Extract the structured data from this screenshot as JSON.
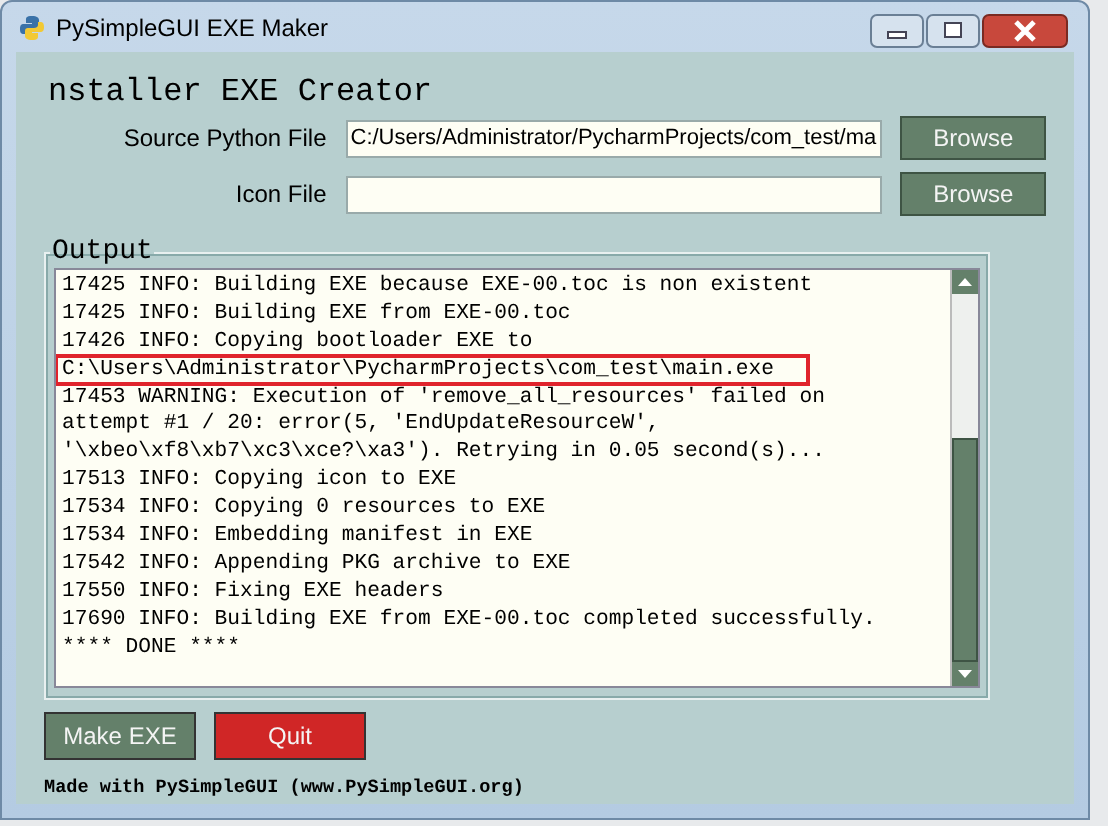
{
  "window": {
    "title": "PySimpleGUI EXE Maker"
  },
  "heading": "nstaller EXE Creator",
  "fields": [
    {
      "label": "Source Python File",
      "value": "C:/Users/Administrator/PycharmProjects/com_test/ma",
      "button": "Browse"
    },
    {
      "label": "Icon File",
      "button": "Browse"
    }
  ],
  "output": {
    "title": "Output",
    "lines": [
      {
        "text": "17425 INFO: Building EXE because EXE-00.toc is non existent",
        "highlighted": false
      },
      {
        "text": "17425 INFO: Building EXE from EXE-00.toc",
        "highlighted": false
      },
      {
        "text": "17426 INFO: Copying bootloader EXE to",
        "highlighted": false
      },
      {
        "text": "C:\\Users\\Administrator\\PycharmProjects\\com_test\\main.exe",
        "highlighted": true
      },
      {
        "text": "17453 WARNING: Execution of 'remove_all_resources' failed on",
        "highlighted": false
      },
      {
        "text": "attempt #1 / 20: error(5, 'EndUpdateResourceW',",
        "highlighted": false
      },
      {
        "text": "'\\xbeo\\xf8\\xb7\\xc3\\xce?\\xa3'). Retrying in 0.05 second(s)...",
        "highlighted": false
      },
      {
        "text": "17513 INFO: Copying icon to EXE",
        "highlighted": false
      },
      {
        "text": "17534 INFO: Copying 0 resources to EXE",
        "highlighted": false
      },
      {
        "text": "17534 INFO: Embedding manifest in EXE",
        "highlighted": false
      },
      {
        "text": "17542 INFO: Appending PKG archive to EXE",
        "highlighted": false
      },
      {
        "text": "17550 INFO: Fixing EXE headers",
        "highlighted": false
      },
      {
        "text": "17690 INFO: Building EXE from EXE-00.toc completed successfully.",
        "highlighted": false
      },
      {
        "text": "**** DONE ****",
        "highlighted": false
      }
    ]
  },
  "buttons": [
    {
      "label": "Make EXE",
      "kind": "primary"
    },
    {
      "label": "Quit",
      "kind": "danger"
    }
  ],
  "footer": "Made with PySimpleGUI (www.PySimpleGUI.org)"
}
